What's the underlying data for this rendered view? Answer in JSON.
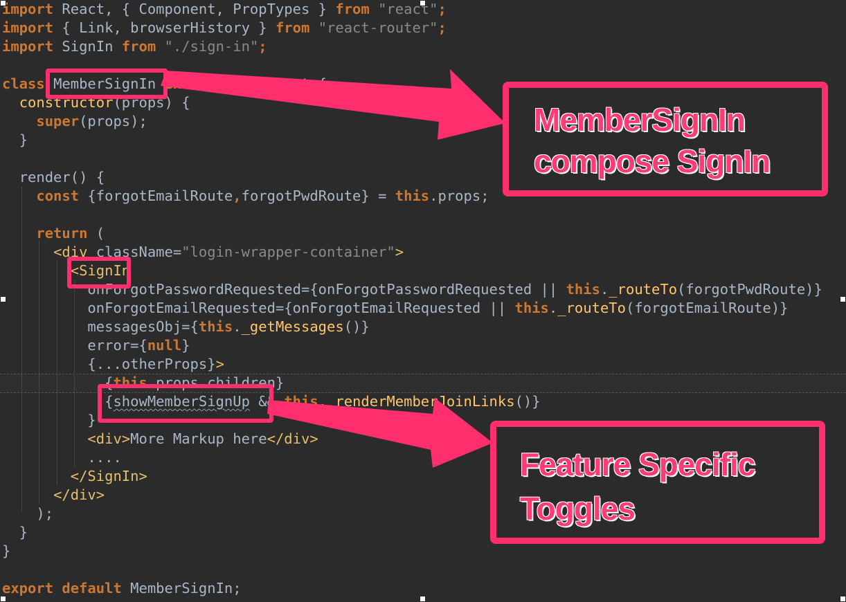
{
  "code": {
    "line1": {
      "kw1": "import",
      "t1": " React, { Component, PropTypes } ",
      "kw2": "from",
      "sp": " ",
      "str": "\"react\"",
      "end": ";"
    },
    "line2": {
      "kw1": "import",
      "t1": " { Link, browserHistory } ",
      "kw2": "from",
      "sp": " ",
      "str": "\"react-router\"",
      "end": ";"
    },
    "line3": {
      "kw1": "import",
      "t1": " SignIn ",
      "kw2": "from",
      "sp": " ",
      "str": "\"./sign-in\"",
      "end": ";"
    },
    "line4": {
      "kw1": "class",
      "sp1": " ",
      "name": "MemberSignIn",
      "sp2": " ",
      "kw2": "extends",
      "t1": " Component {"
    },
    "line5": {
      "indent": "  ",
      "fn": "constructor",
      "t1": "(props) {"
    },
    "line6": {
      "indent": "    ",
      "kw": "super",
      "t1": "(props);"
    },
    "line7": {
      "t1": "  }"
    },
    "line8": {
      "indent": "  ",
      "t1": "render() {"
    },
    "line9": {
      "indent": "    ",
      "kw1": "const",
      "t1": " {forgotEmailRoute",
      "comma": ",",
      "t2": "forgotPwdRoute} = ",
      "kw2": "this",
      "t3": ".props;"
    },
    "line10": {
      "indent": "    ",
      "kw": "return",
      "t1": " ("
    },
    "line11": {
      "indent": "      ",
      "tag1": "<div",
      "t1": " className=",
      "str": "\"login-wrapper-container\"",
      "tag2": ">"
    },
    "line12": {
      "indent": "        ",
      "tag": "<SignIn"
    },
    "line13": {
      "indent": "          ",
      "t1": "onForgotPasswordRequested={onForgotPasswordRequested || ",
      "kw": "this",
      "t2": ".",
      "fn": "_routeTo",
      "t3": "(forgotPwdRoute)}"
    },
    "line14": {
      "indent": "          ",
      "t1": "onForgotEmailRequested={onForgotEmailRequested || ",
      "kw": "this",
      "t2": ".",
      "fn": "_routeTo",
      "t3": "(forgotEmailRoute)}"
    },
    "line15": {
      "indent": "          ",
      "t1": "messagesObj={",
      "kw": "this",
      "t2": ".",
      "fn": "_getMessages",
      "t3": "()}"
    },
    "line16": {
      "indent": "          ",
      "t1": "error={",
      "kw": "null",
      "t2": "}"
    },
    "line17": {
      "indent": "          ",
      "t1": "{...otherProps}",
      "tag": ">"
    },
    "line18": {
      "indent": "            ",
      "t1": "{",
      "kw": "this",
      "t2": ".props.children}"
    },
    "line19": {
      "indent": "            ",
      "t1": "{",
      "sq": "showMemberSignUp",
      "t2": " && ",
      "kw": "this",
      "t3": ".",
      "fn": "_renderMemberJoinLinks",
      "t4": "()}"
    },
    "line20": {
      "indent": "          ",
      "t1": "}"
    },
    "line21": {
      "indent": "          ",
      "tag1": "<div>",
      "t1": "More Markup here",
      "tag2": "</div>"
    },
    "line22": {
      "indent": "          ",
      "t1": "...."
    },
    "line23": {
      "indent": "        ",
      "tag": "</SignIn>"
    },
    "line24": {
      "indent": "      ",
      "tag": "</div>"
    },
    "line25": {
      "t1": "    );"
    },
    "line26": {
      "t1": "  }"
    },
    "line27": {
      "t1": "}"
    },
    "line28": {
      "kw1": "export",
      "sp": " ",
      "kw2": "default",
      "t1": " MemberSignIn;"
    }
  },
  "annotations": {
    "callout1": {
      "line1": "MemberSignIn",
      "line2": "compose SignIn"
    },
    "callout2": {
      "line1": "Feature Specific",
      "line2": "Toggles"
    }
  },
  "colors": {
    "background": "#2b2b2b",
    "keyword": "#cc7832",
    "string": "#8a8a8a",
    "function": "#ffc66d",
    "tag": "#e8bf6a",
    "text": "#a9b7c6",
    "annotation": "#ff2f6d"
  }
}
